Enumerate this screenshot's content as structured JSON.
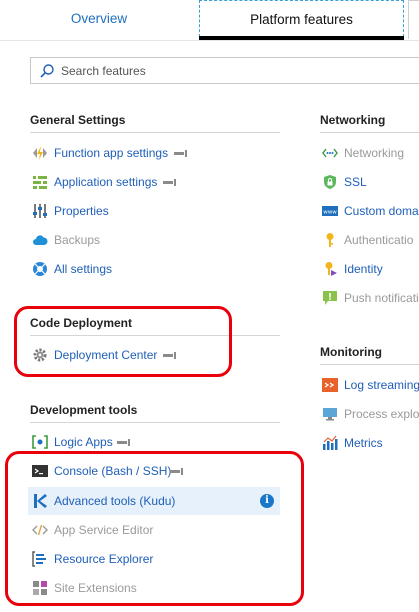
{
  "tabs": {
    "overview": "Overview",
    "platform": "Platform features"
  },
  "search": {
    "placeholder": "Search features"
  },
  "general": {
    "heading": "General Settings",
    "items": [
      "Function app settings",
      "Application settings",
      "Properties",
      "Backups",
      "All settings"
    ]
  },
  "code_deployment": {
    "heading": "Code Deployment",
    "items": [
      "Deployment Center"
    ]
  },
  "dev_tools": {
    "heading": "Development tools",
    "items": [
      "Logic Apps",
      "Console (Bash / SSH)",
      "Advanced tools (Kudu)",
      "App Service Editor",
      "Resource Explorer",
      "Site Extensions"
    ]
  },
  "networking": {
    "heading": "Networking",
    "items": [
      "Networking",
      "SSL",
      "Custom domai",
      "Authenticatio",
      "Identity",
      "Push notificati"
    ]
  },
  "monitoring": {
    "heading": "Monitoring",
    "items": [
      "Log streaming",
      "Process explor",
      "Metrics"
    ]
  },
  "info_icon": "i",
  "colors": {
    "link": "#1f5fb8",
    "highlight_box": "#e8000b",
    "selected_row": "#e6f1fb"
  }
}
